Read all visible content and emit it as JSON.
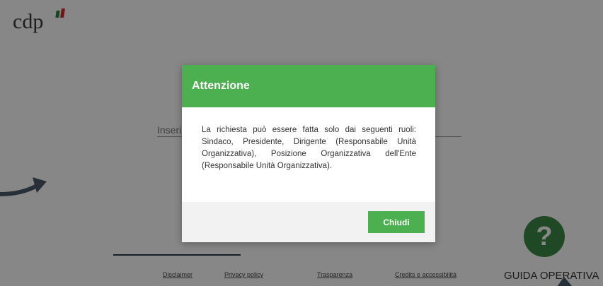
{
  "header": {
    "logo_text": "cdp"
  },
  "form": {
    "input_placeholder": "Inserisci"
  },
  "footer": {
    "links": [
      "Disclaimer",
      "Privacy policy",
      "Trasparenza",
      "Credits e accessibilità"
    ]
  },
  "help": {
    "icon_text": "?",
    "label": "GUIDA OPERATIVA"
  },
  "modal": {
    "title": "Attenzione",
    "message": "La richiesta può essere fatta solo dai seguenti ruoli: Sindaco, Presidente, Dirigente (Responsabile Unità Organizzativa), Posizione Organizzativa dell'Ente (Responsabile Unità Organizzativa).",
    "close_label": "Chiudi"
  },
  "colors": {
    "accent_green": "#4caf50",
    "help_green": "#3c8a45",
    "flag_green": "#1f8a3b",
    "flag_red": "#d62b2b"
  }
}
